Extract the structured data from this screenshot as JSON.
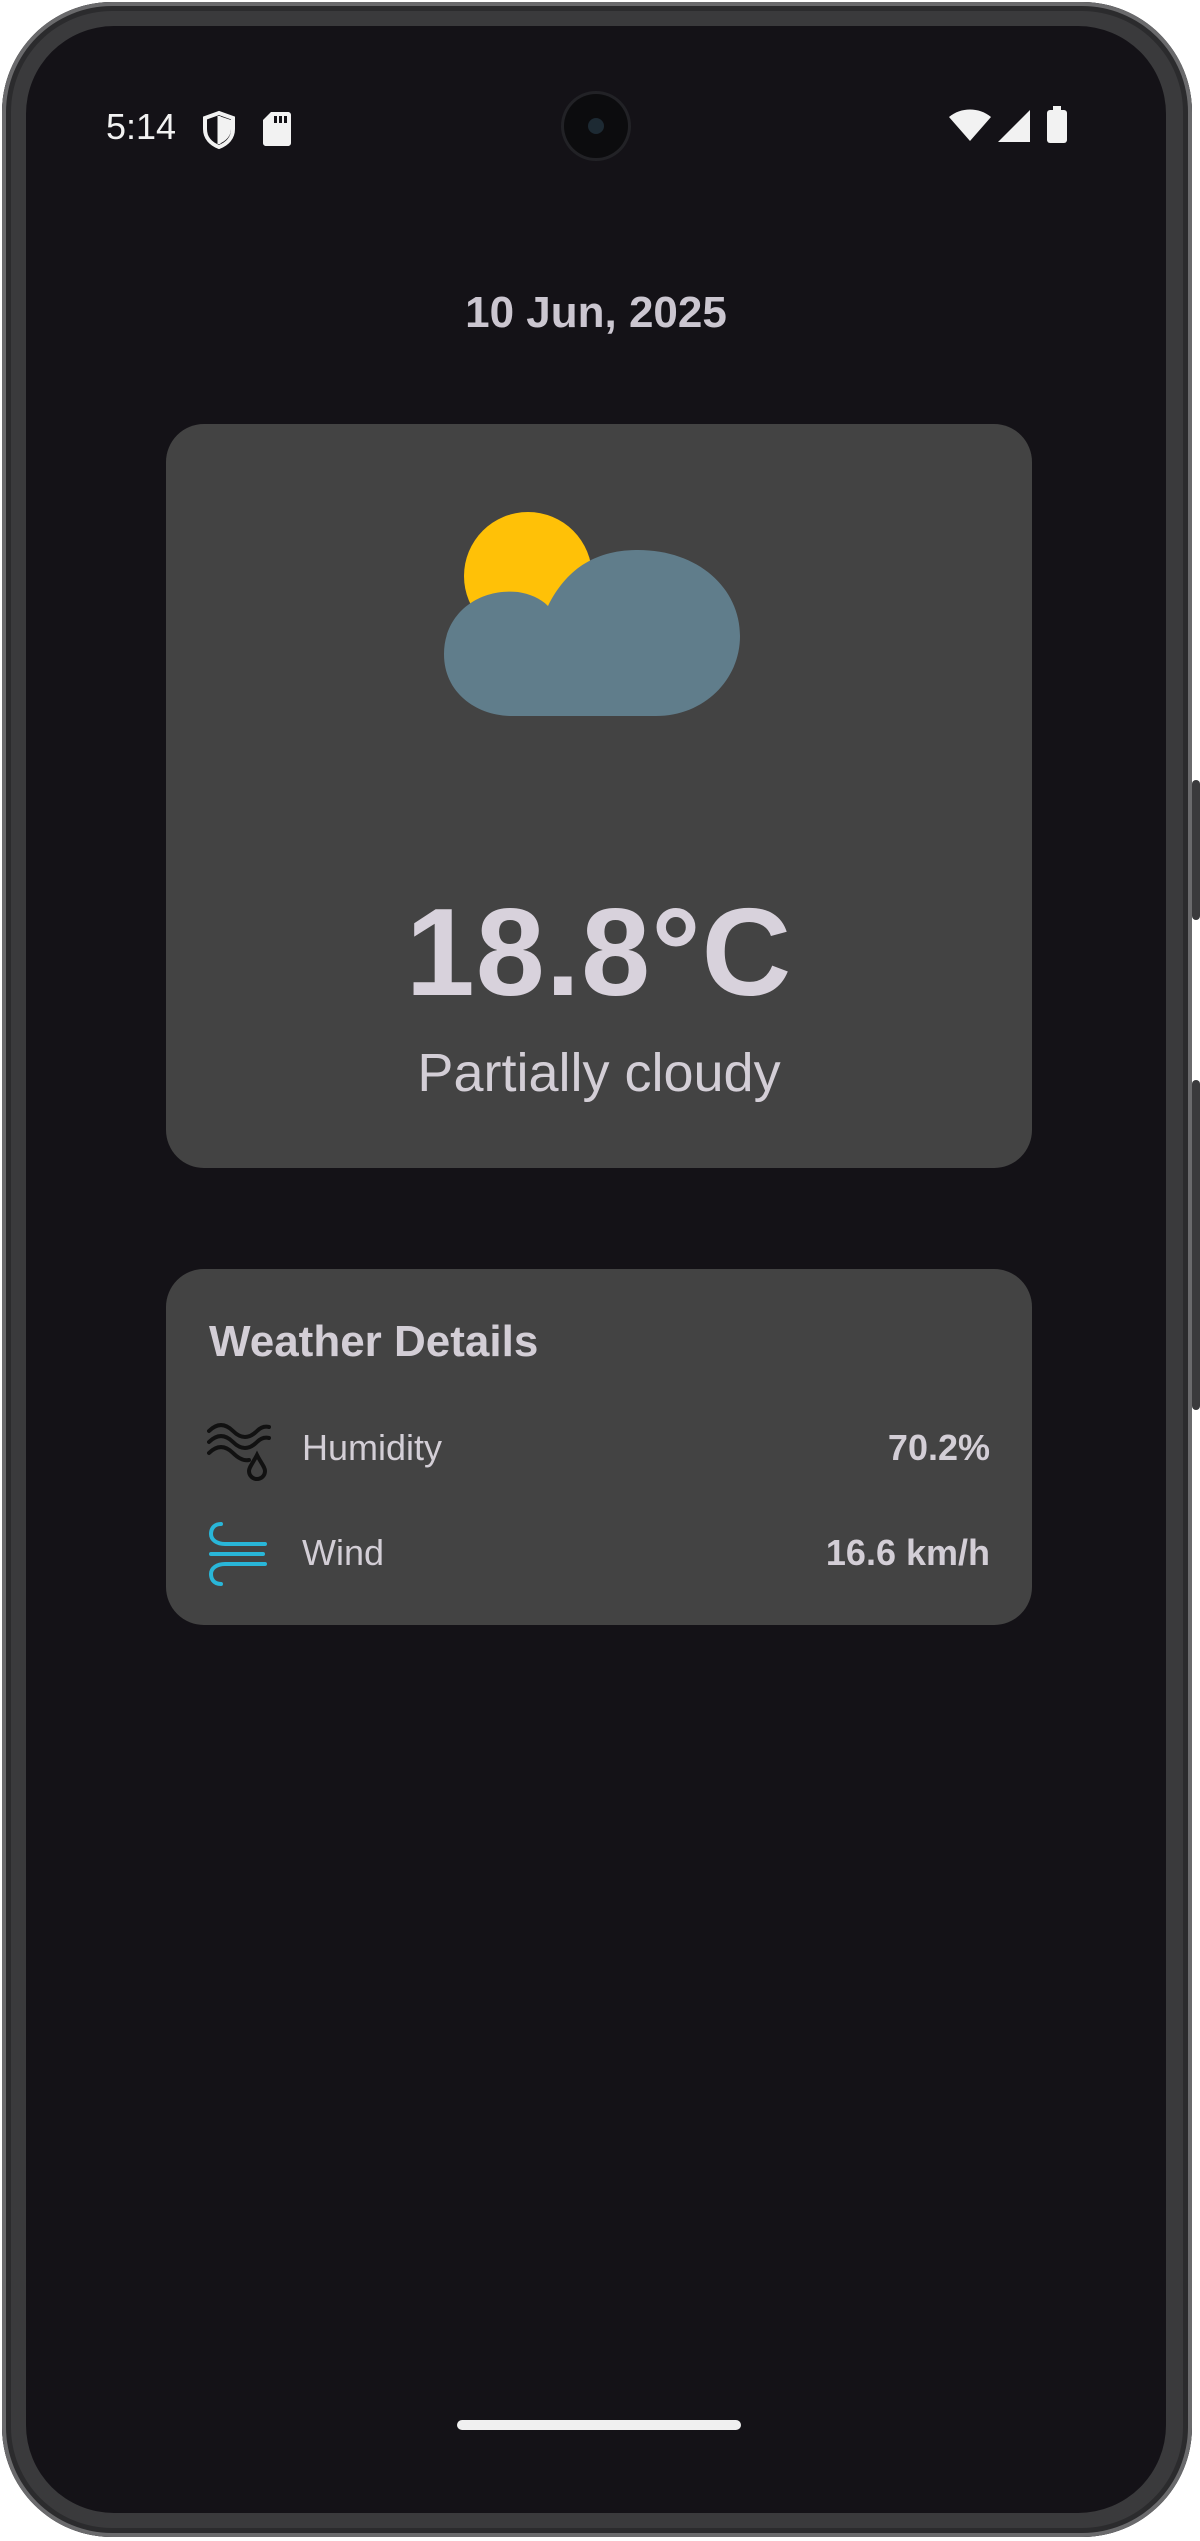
{
  "status_bar": {
    "time": "5:14",
    "icons": [
      "shield-icon",
      "sd-card-icon",
      "wifi-icon",
      "signal-icon",
      "battery-icon"
    ]
  },
  "header": {
    "date": "10 Jun, 2025"
  },
  "current": {
    "icon": "partly-cloudy-icon",
    "temperature": "18.8°C",
    "condition": "Partially cloudy"
  },
  "details": {
    "title": "Weather Details",
    "rows": [
      {
        "icon": "humidity-icon",
        "label": "Humidity",
        "value": "70.2%"
      },
      {
        "icon": "wind-icon",
        "label": "Wind",
        "value": "16.6 km/h"
      }
    ]
  },
  "colors": {
    "background": "#141217",
    "card": "#434343",
    "sun": "#FFC107",
    "cloud": "#607D8B",
    "wind_icon": "#29B6D8",
    "text": "#D3CED6"
  }
}
